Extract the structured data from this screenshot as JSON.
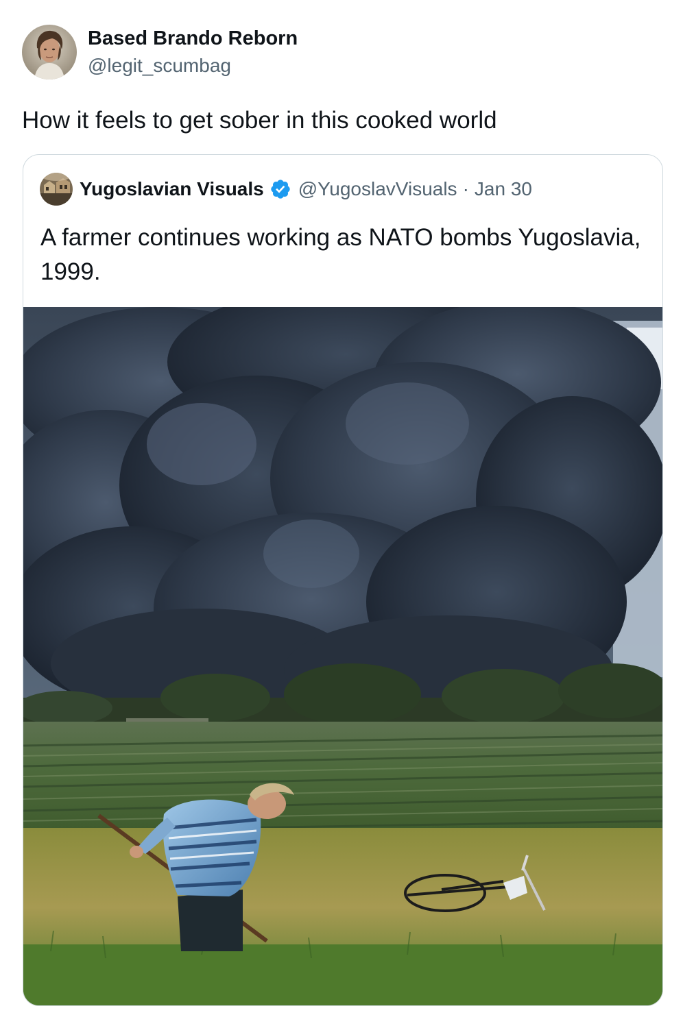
{
  "author": {
    "display_name": "Based Brando Reborn",
    "handle": "@legit_scumbag",
    "avatar_icon": "person-avatar-icon"
  },
  "tweet": {
    "text": "How it feels to get sober in this cooked world"
  },
  "quoted": {
    "display_name": "Yugoslavian Visuals",
    "verified": true,
    "verified_color": "#1d9bf0",
    "handle": "@YugoslavVisuals",
    "separator": "·",
    "date": "Jan 30",
    "text": "A farmer continues working as NATO bombs Yugoslavia, 1999.",
    "media_icon": "photo-smoke-field-farmer-icon"
  },
  "colors": {
    "text_primary": "#0f1419",
    "text_secondary": "#536471",
    "border": "#cfd9de"
  }
}
